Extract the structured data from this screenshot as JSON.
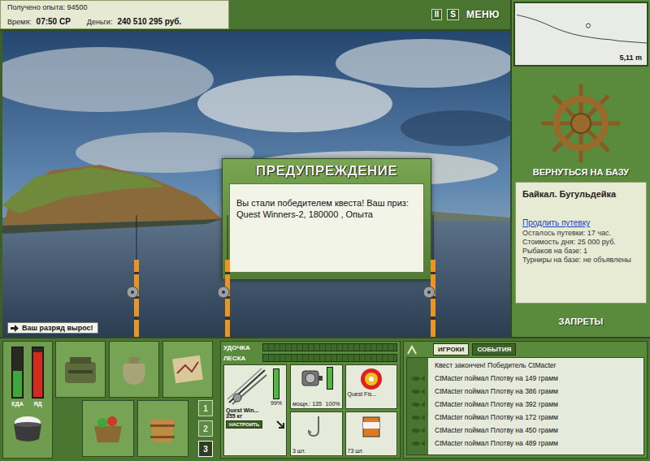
{
  "header": {
    "experience": "Получено опыта: 94500",
    "time_label": "Время:",
    "time": "07:50 СР",
    "money_label": "Деньги:",
    "money": "240 510 295 руб."
  },
  "toolbar": [
    "II",
    "S",
    "МЕНЮ"
  ],
  "dialog": {
    "title": "ПРЕДУПРЕЖДЕНИЕ",
    "message": "Вы стали победителем квеста! Ваш приз: Quest Winners-2, 180000 , Опыта"
  },
  "notification": "Ваш разряд вырос!",
  "depth": {
    "reading": "5,11 m",
    "profile": [
      1.2,
      1.5,
      1.9,
      2.4,
      3.0,
      3.5,
      3.9,
      4.2,
      4.4,
      4.6,
      4.7,
      4.9,
      5.0,
      5.1,
      5.2
    ],
    "marker_level": 0.55
  },
  "base": {
    "button": "ВЕРНУТЬСЯ НА БАЗУ",
    "location": "Байкал. Бугульдейка",
    "link": "Продлить путевку",
    "info": [
      "Осталось путевки: 17 час.",
      "Стоимость дня: 25 000 руб.",
      "Рыбаков на базе: 1",
      "Турниры на базе: не объявлены"
    ],
    "bans": "ЗАПРЕТЫ"
  },
  "meters": [
    {
      "label": "ЕДА",
      "level": 0.55,
      "color": "#3fa63a"
    },
    {
      "label": "ЯД",
      "level": 0.92,
      "color": "#d42a1e"
    }
  ],
  "slots": [
    {
      "label": "1",
      "selected": false
    },
    {
      "label": "2",
      "selected": false
    },
    {
      "label": "3",
      "selected": true
    }
  ],
  "tackle": {
    "bars": [
      {
        "label": "УДОЧКА",
        "level": 0
      },
      {
        "label": "ЛЕСКА",
        "level": 0
      }
    ],
    "rod": {
      "name": "Quest Win...",
      "capacity": "355 кг",
      "button": "НАСТРОИТЬ",
      "condition": "99%",
      "level": 0.99
    },
    "reel": {
      "power": "мощн.: 135",
      "condition": "100%",
      "level": 1
    },
    "line": {
      "name": "Quest Fis..."
    },
    "hook": {
      "count": "3 шт."
    },
    "bait": {
      "count": "73 шт."
    }
  },
  "chat": {
    "tabs": [
      {
        "label": "ИГРОКИ",
        "selected": true
      },
      {
        "label": "СОБЫТИЯ",
        "selected": false
      }
    ],
    "messages": [
      {
        "text": "Квест закончен! Победитель CtMacter",
        "kind": "system"
      },
      {
        "text": "CtMacter поймал Плотву на 149 грамм",
        "kind": "catch"
      },
      {
        "text": "CtMacter поймал Плотву на 386 грамм",
        "kind": "catch"
      },
      {
        "text": "CtMacter поймал Плотву на 392 грамм",
        "kind": "catch"
      },
      {
        "text": "CtMacter поймал Плотву на 172 грамм",
        "kind": "catch"
      },
      {
        "text": "CtMacter поймал Плотву на 450 грамм",
        "kind": "catch"
      },
      {
        "text": "CtMacter поймал Плотву на 489 грамм",
        "kind": "catch"
      }
    ]
  }
}
